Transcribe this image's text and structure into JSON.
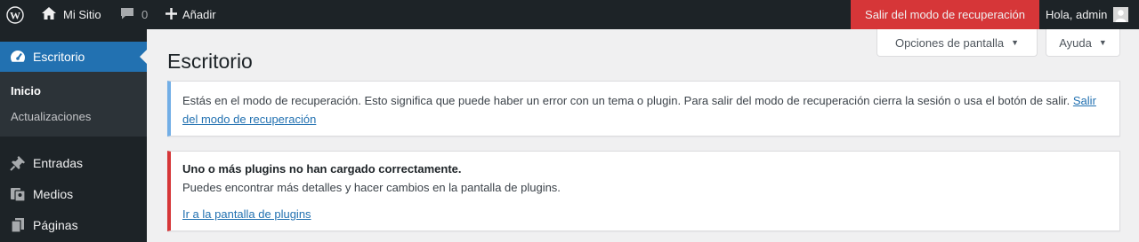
{
  "adminbar": {
    "site_name": "Mi Sitio",
    "comments_count": "0",
    "new_label": "Añadir",
    "recovery_exit": "Salir del modo de recuperación",
    "account_greeting": "Hola, admin"
  },
  "sidebar": {
    "items": [
      {
        "label": "Escritorio",
        "icon": "dashboard-icon",
        "active": true
      },
      {
        "label": "Entradas",
        "icon": "pin-icon"
      },
      {
        "label": "Medios",
        "icon": "media-icon"
      },
      {
        "label": "Páginas",
        "icon": "page-icon"
      }
    ],
    "submenu": [
      {
        "label": "Inicio",
        "current": true
      },
      {
        "label": "Actualizaciones"
      }
    ]
  },
  "screen_meta": {
    "options_label": "Opciones de pantalla",
    "help_label": "Ayuda"
  },
  "page": {
    "title": "Escritorio"
  },
  "notices": {
    "recovery": {
      "text": "Estás en el modo de recuperación. Esto significa que puede haber un error con un tema o plugin. Para salir del modo de recuperación cierra la sesión o usa el botón de salir.",
      "link": "Salir del modo de recuperación"
    },
    "plugins_error": {
      "title": "Uno o más plugins no han cargado correctamente.",
      "text": "Puedes encontrar más detalles y hacer cambios en la pantalla de plugins.",
      "link": "Ir a la pantalla de plugins"
    }
  },
  "colors": {
    "adminbar_bg": "#1d2327",
    "accent": "#2271b1",
    "recovery_red": "#d63638",
    "info_border": "#72aee6"
  }
}
